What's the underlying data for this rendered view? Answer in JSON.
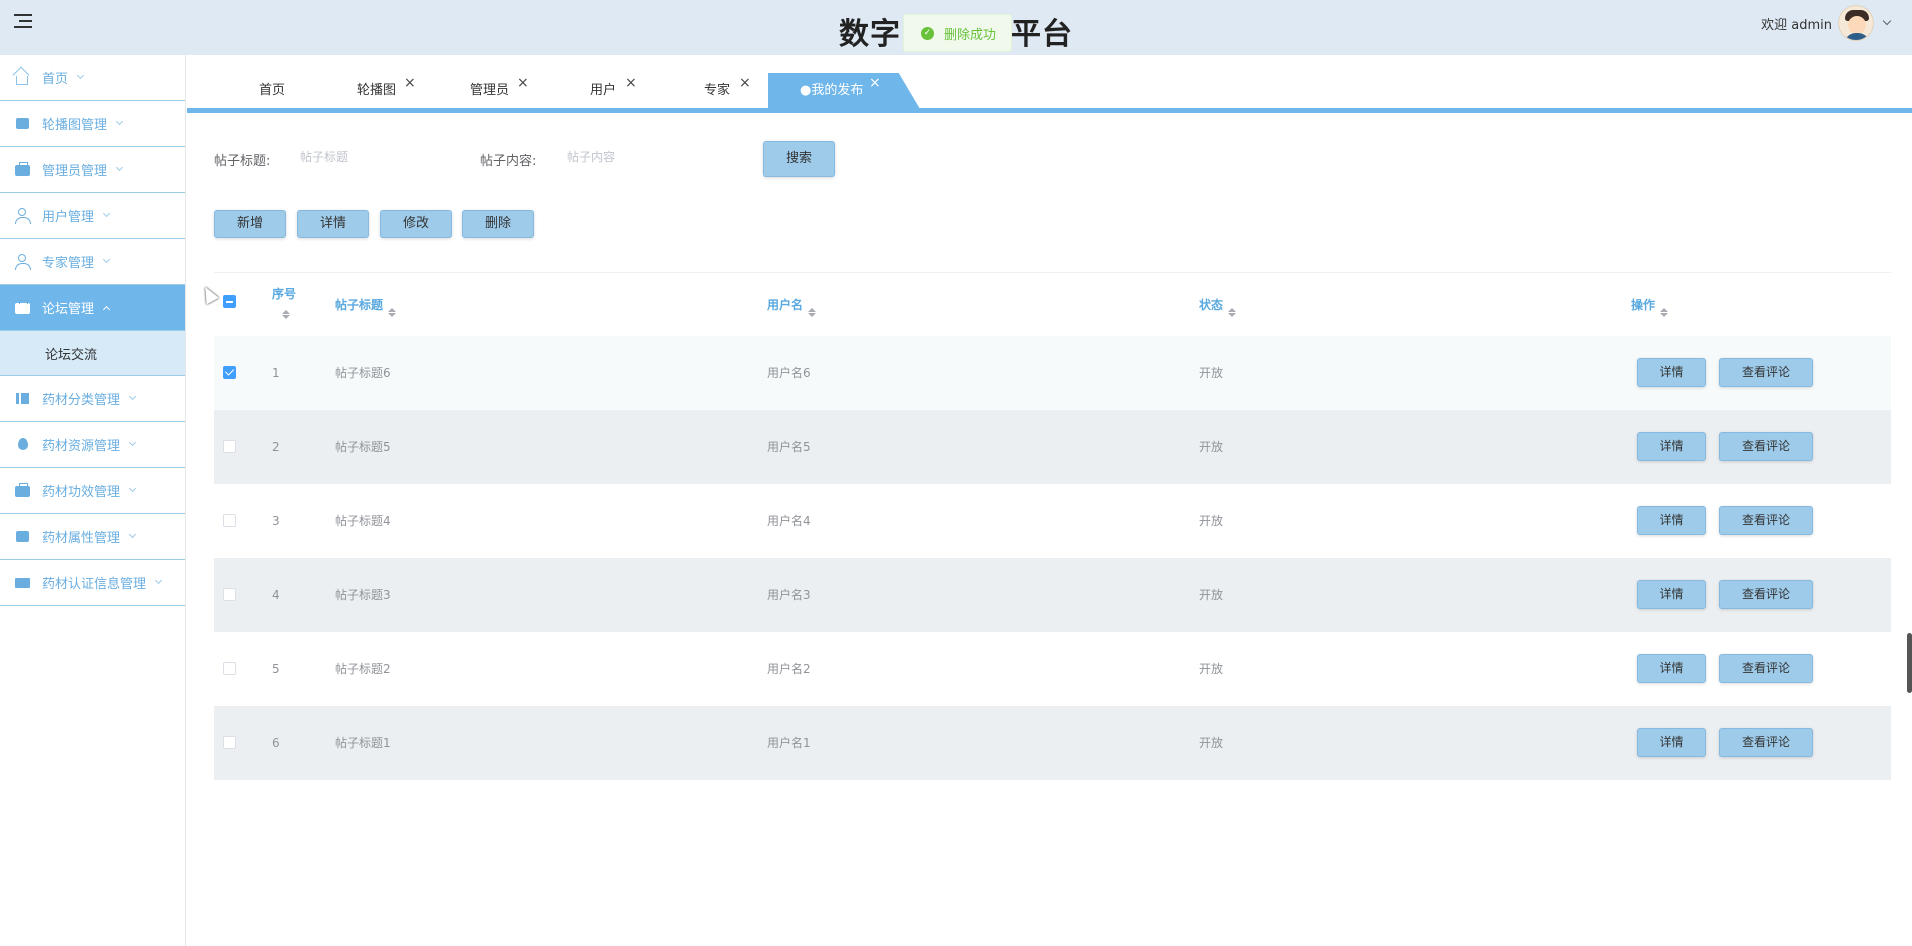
{
  "header": {
    "title_left": "数字",
    "title_right": "平台",
    "toast": "删除成功",
    "welcome": "欢迎 admin"
  },
  "sidebar": {
    "items": [
      {
        "label": "首页",
        "icon": "home-icon"
      },
      {
        "label": "轮播图管理",
        "icon": "carousel-icon"
      },
      {
        "label": "管理员管理",
        "icon": "briefcase-icon"
      },
      {
        "label": "用户管理",
        "icon": "user-icon"
      },
      {
        "label": "专家管理",
        "icon": "expert-icon"
      },
      {
        "label": "论坛管理",
        "icon": "forum-icon"
      },
      {
        "label": "药材分类管理",
        "icon": "category-icon"
      },
      {
        "label": "药材资源管理",
        "icon": "drop-icon"
      },
      {
        "label": "药材功效管理",
        "icon": "archive-icon"
      },
      {
        "label": "药材属性管理",
        "icon": "attribute-icon"
      },
      {
        "label": "药材认证信息管理",
        "icon": "certificate-icon"
      }
    ],
    "subitem": "论坛交流"
  },
  "tabs": [
    "首页",
    "轮播图",
    "管理员",
    "用户",
    "专家"
  ],
  "active_tab": "●我的发布",
  "search": {
    "title_label": "帖子标题:",
    "title_placeholder": "帖子标题",
    "content_label": "帖子内容:",
    "content_placeholder": "帖子内容",
    "search_button": "搜索"
  },
  "actions": {
    "add": "新增",
    "detail": "详情",
    "edit": "修改",
    "delete": "删除"
  },
  "table": {
    "columns": [
      "序号",
      "帖子标题",
      "用户名",
      "状态",
      "操作"
    ],
    "rows": [
      {
        "index": "1",
        "title": "帖子标题6",
        "user": "用户名6",
        "status": "开放",
        "checked": true
      },
      {
        "index": "2",
        "title": "帖子标题5",
        "user": "用户名5",
        "status": "开放",
        "checked": false
      },
      {
        "index": "3",
        "title": "帖子标题4",
        "user": "用户名4",
        "status": "开放",
        "checked": false
      },
      {
        "index": "4",
        "title": "帖子标题3",
        "user": "用户名3",
        "status": "开放",
        "checked": false
      },
      {
        "index": "5",
        "title": "帖子标题2",
        "user": "用户名2",
        "status": "开放",
        "checked": false
      },
      {
        "index": "6",
        "title": "帖子标题1",
        "user": "用户名1",
        "status": "开放",
        "checked": false
      }
    ],
    "row_detail_button": "详情",
    "row_comments_button": "查看评论"
  },
  "colors": {
    "accent": "#6fb6eb",
    "button": "#9ecbea",
    "success": "#67c23a"
  }
}
